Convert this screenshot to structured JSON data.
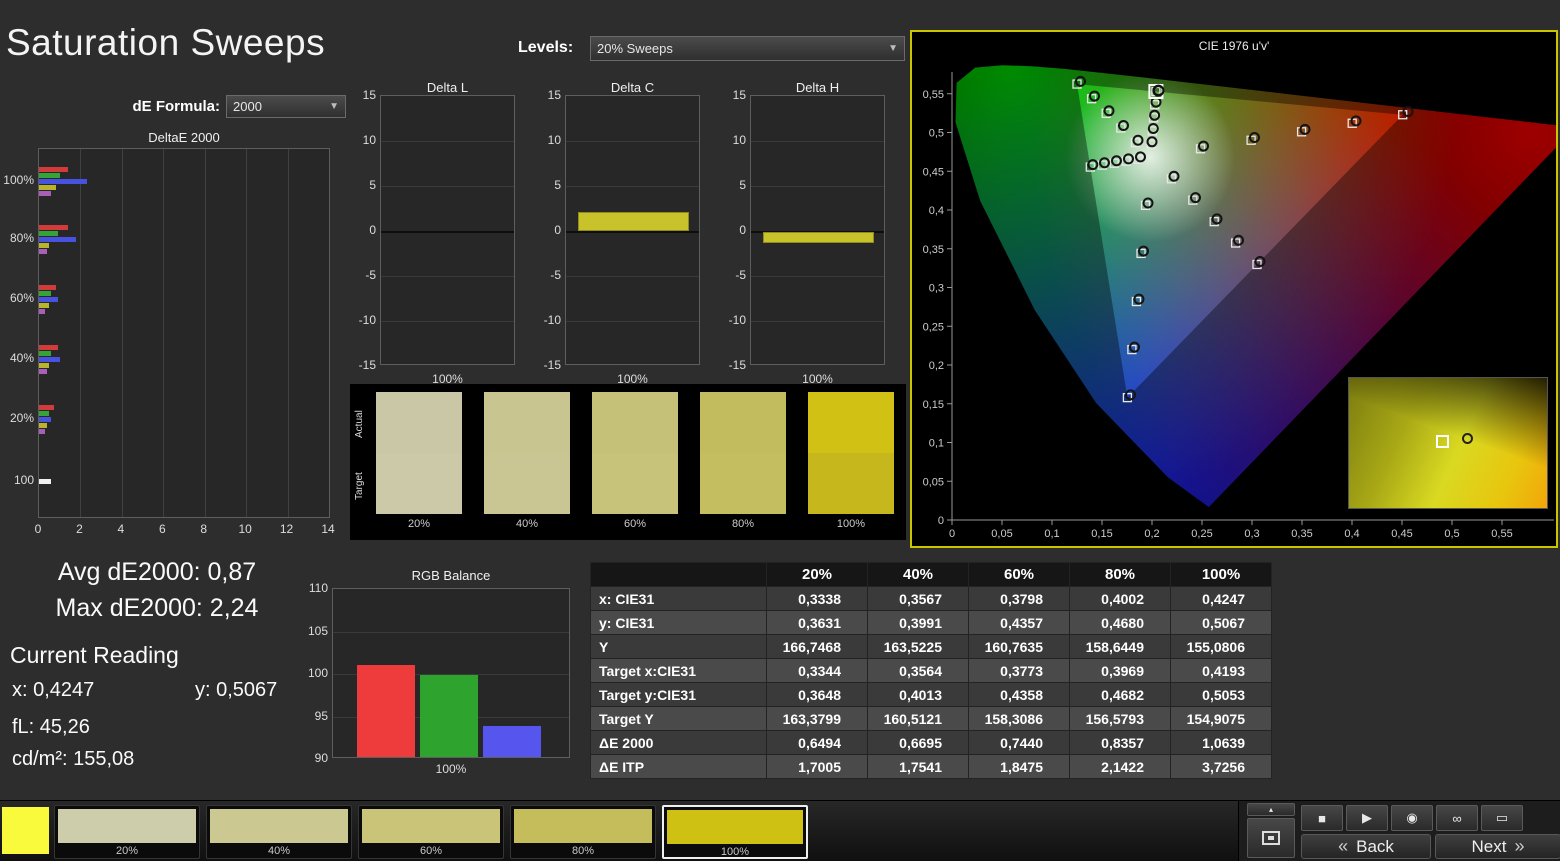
{
  "header": {
    "title": "Saturation Sweeps",
    "levels_label": "Levels:",
    "levels_value": "20% Sweeps",
    "de_formula_label": "dE Formula:",
    "de_formula_value": "2000"
  },
  "deltae_chart": {
    "title": "DeltaE 2000",
    "x_max": 14,
    "x_ticks": [
      "0",
      "2",
      "4",
      "6",
      "8",
      "10",
      "12",
      "14"
    ],
    "row_labels": [
      "100%",
      "80%",
      "60%",
      "40%",
      "20%",
      "100"
    ],
    "series_colors": [
      "#d23b3b",
      "#36a336",
      "#4752e0",
      "#b8b42e",
      "#a95fb8"
    ],
    "groups": [
      {
        "label": "100%",
        "values": [
          1.4,
          1.0,
          2.3,
          0.8,
          0.6
        ]
      },
      {
        "label": "80%",
        "values": [
          1.4,
          0.9,
          1.8,
          0.5,
          0.4
        ]
      },
      {
        "label": "60%",
        "values": [
          0.8,
          0.6,
          0.9,
          0.5,
          0.3
        ]
      },
      {
        "label": "40%",
        "values": [
          0.9,
          0.6,
          1.0,
          0.5,
          0.4
        ]
      },
      {
        "label": "20%",
        "values": [
          0.7,
          0.5,
          0.6,
          0.4,
          0.3
        ]
      },
      {
        "label": "100",
        "values": [
          0.6
        ],
        "colors": [
          "#f0f0f0"
        ]
      }
    ]
  },
  "delta_axis": {
    "max": 15,
    "min": -15,
    "ticks": [
      15,
      10,
      5,
      0,
      -5,
      -10,
      -15
    ]
  },
  "delta_charts": [
    {
      "title": "Delta L",
      "value": 0,
      "x_label": "100%"
    },
    {
      "title": "Delta C",
      "value": 2.1,
      "x_label": "100%"
    },
    {
      "title": "Delta H",
      "value": -1.2,
      "x_label": "100%"
    }
  ],
  "patch_compare": {
    "row_labels": [
      "Actual",
      "Target"
    ],
    "items": [
      {
        "label": "20%",
        "actual": "#c9c7a6",
        "target": "#cbc9a8"
      },
      {
        "label": "40%",
        "actual": "#c8c591",
        "target": "#cac693"
      },
      {
        "label": "60%",
        "actual": "#c6c179",
        "target": "#c8c37b"
      },
      {
        "label": "80%",
        "actual": "#c3bc5e",
        "target": "#c5be60"
      },
      {
        "label": "100%",
        "actual": "#d1c114",
        "target": "#c6b81c"
      }
    ]
  },
  "cie": {
    "title": "CIE 1976 u'v'",
    "border_color": "#c9c600",
    "x_ticks": [
      "0",
      "0,05",
      "0,1",
      "0,15",
      "0,2",
      "0,25",
      "0,3",
      "0,35",
      "0,4",
      "0,45",
      "0,5",
      "0,55"
    ],
    "y_ticks": [
      "0",
      "0,05",
      "0,1",
      "0,15",
      "0,2",
      "0,25",
      "0,3",
      "0,35",
      "0,4",
      "0,45",
      "0,5",
      "0,55"
    ],
    "white_point": [
      0.1978,
      0.4683
    ],
    "sweeps": [
      {
        "name": "red",
        "targets": [
          [
            0.2485,
            0.479
          ],
          [
            0.2991,
            0.49
          ],
          [
            0.3496,
            0.5009
          ],
          [
            0.4002,
            0.5119
          ],
          [
            0.4507,
            0.5229
          ]
        ],
        "measured": [
          [
            0.2515,
            0.4825
          ],
          [
            0.3025,
            0.4935
          ],
          [
            0.353,
            0.504
          ],
          [
            0.404,
            0.515
          ],
          [
            0.456,
            0.527
          ]
        ]
      },
      {
        "name": "green",
        "targets": [
          [
            0.1834,
            0.4869
          ],
          [
            0.1688,
            0.5058
          ],
          [
            0.1542,
            0.5247
          ],
          [
            0.1396,
            0.5436
          ],
          [
            0.125,
            0.5625
          ]
        ],
        "measured": [
          [
            0.186,
            0.49
          ],
          [
            0.1715,
            0.509
          ],
          [
            0.157,
            0.528
          ],
          [
            0.1425,
            0.547
          ],
          [
            0.1285,
            0.566
          ]
        ]
      },
      {
        "name": "blue",
        "targets": [
          [
            0.1935,
            0.406
          ],
          [
            0.189,
            0.344
          ],
          [
            0.1844,
            0.2819
          ],
          [
            0.1799,
            0.2199
          ],
          [
            0.1754,
            0.1579
          ]
        ],
        "measured": [
          [
            0.196,
            0.409
          ],
          [
            0.1915,
            0.347
          ],
          [
            0.187,
            0.285
          ],
          [
            0.1825,
            0.223
          ],
          [
            0.1785,
            0.1615
          ]
        ]
      },
      {
        "name": "cyan",
        "targets": [
          [
            0.1861,
            0.4655
          ],
          [
            0.1741,
            0.463
          ],
          [
            0.1622,
            0.4604
          ],
          [
            0.1502,
            0.4579
          ],
          [
            0.1383,
            0.4554
          ]
        ],
        "measured": [
          [
            0.1885,
            0.4685
          ],
          [
            0.1765,
            0.466
          ],
          [
            0.1645,
            0.4635
          ],
          [
            0.1525,
            0.461
          ],
          [
            0.1408,
            0.4585
          ]
        ]
      },
      {
        "name": "magenta",
        "targets": [
          [
            0.2194,
            0.4403
          ],
          [
            0.2408,
            0.4127
          ],
          [
            0.2622,
            0.385
          ],
          [
            0.2836,
            0.3574
          ],
          [
            0.305,
            0.3297
          ]
        ],
        "measured": [
          [
            0.222,
            0.4435
          ],
          [
            0.2435,
            0.416
          ],
          [
            0.265,
            0.3885
          ],
          [
            0.2865,
            0.361
          ],
          [
            0.308,
            0.3335
          ]
        ]
      },
      {
        "name": "yellow",
        "targets": [
          [
            0.1992,
            0.485
          ],
          [
            0.2004,
            0.502
          ],
          [
            0.2015,
            0.5189
          ],
          [
            0.2027,
            0.5359
          ],
          [
            0.2039,
            0.5529
          ]
        ],
        "measured": [
          [
            0.2,
            0.488
          ],
          [
            0.2013,
            0.5052
          ],
          [
            0.2026,
            0.5222
          ],
          [
            0.204,
            0.5392
          ],
          [
            0.2064,
            0.5541
          ]
        ]
      }
    ],
    "current": {
      "target": [
        0.2039,
        0.5529
      ],
      "measured": [
        0.2064,
        0.5541
      ]
    }
  },
  "stats": {
    "avg": "Avg dE2000: 0,87",
    "max": "Max dE2000: 2,24",
    "current_reading_label": "Current Reading",
    "x": "x: 0,4247",
    "y": "y: 0,5067",
    "fl": "fL: 45,26",
    "cdm2": "cd/m²: 155,08"
  },
  "rgb_balance": {
    "title": "RGB Balance",
    "y_ticks": [
      110,
      105,
      100,
      95,
      90
    ],
    "y_min": 90,
    "y_max": 110,
    "x_label": "100%",
    "bars": [
      {
        "name": "red",
        "value": 100.8,
        "color": "#ee3b3b"
      },
      {
        "name": "green",
        "value": 99.7,
        "color": "#2ea42e"
      },
      {
        "name": "blue",
        "value": 93.7,
        "color": "#5656ee"
      }
    ]
  },
  "table": {
    "columns": [
      "20%",
      "40%",
      "60%",
      "80%",
      "100%"
    ],
    "rows": [
      {
        "label": "x: CIE31",
        "values": [
          "0,3338",
          "0,3567",
          "0,3798",
          "0,4002",
          "0,4247"
        ]
      },
      {
        "label": "y: CIE31",
        "values": [
          "0,3631",
          "0,3991",
          "0,4357",
          "0,4680",
          "0,5067"
        ]
      },
      {
        "label": "Y",
        "values": [
          "166,7468",
          "163,5225",
          "160,7635",
          "158,6449",
          "155,0806"
        ]
      },
      {
        "label": "Target x:CIE31",
        "values": [
          "0,3344",
          "0,3564",
          "0,3773",
          "0,3969",
          "0,4193"
        ]
      },
      {
        "label": "Target y:CIE31",
        "values": [
          "0,3648",
          "0,4013",
          "0,4358",
          "0,4682",
          "0,5053"
        ]
      },
      {
        "label": "Target Y",
        "values": [
          "163,3799",
          "160,5121",
          "158,3086",
          "156,5793",
          "154,9075"
        ]
      },
      {
        "label": "ΔE 2000",
        "values": [
          "0,6494",
          "0,6695",
          "0,7440",
          "0,8357",
          "1,0639"
        ]
      },
      {
        "label": "ΔE ITP",
        "values": [
          "1,7005",
          "1,7541",
          "1,8475",
          "2,1422",
          "3,7256"
        ]
      }
    ]
  },
  "bottom_bar": {
    "current_patch_color": "#fafa3c",
    "patches": [
      {
        "label": "20%",
        "color": "#cdccab",
        "selected": false
      },
      {
        "label": "40%",
        "color": "#cbc892",
        "selected": false
      },
      {
        "label": "60%",
        "color": "#c9c478",
        "selected": false
      },
      {
        "label": "80%",
        "color": "#c5bd5b",
        "selected": false
      },
      {
        "label": "100%",
        "color": "#cfc014",
        "selected": true
      }
    ],
    "icons": [
      {
        "name": "stop",
        "glyph": "■"
      },
      {
        "name": "play",
        "glyph": "▶"
      },
      {
        "name": "meter",
        "glyph": "◉"
      },
      {
        "name": "continuous",
        "glyph": "∞"
      },
      {
        "name": "display",
        "glyph": "▭"
      }
    ],
    "tray_toggle_glyph": "▴",
    "back_chevron": "«",
    "back_label": "Back",
    "next_label": "Next",
    "next_chevron": "»"
  }
}
